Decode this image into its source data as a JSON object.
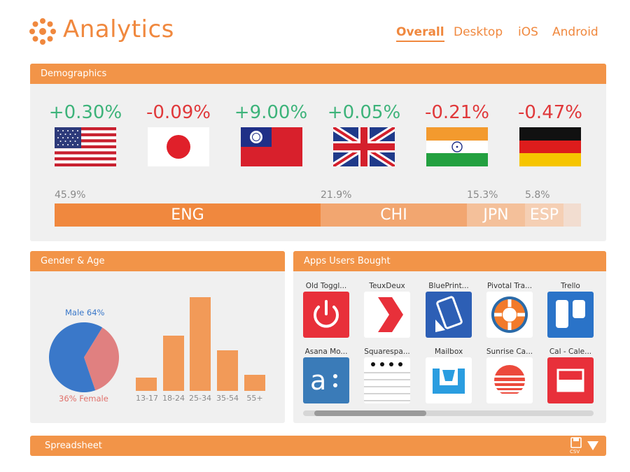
{
  "header": {
    "title": "Analytics",
    "tabs": [
      {
        "label": "Overall",
        "active": true
      },
      {
        "label": "Desktop",
        "active": false
      },
      {
        "label": "iOS",
        "active": false
      },
      {
        "label": "Android",
        "active": false
      }
    ]
  },
  "colors": {
    "accent": "#f0883e",
    "panel_header": "#f29448",
    "positive": "#3db37a",
    "negative": "#e0383a"
  },
  "demographics": {
    "title": "Demographics",
    "countries": [
      {
        "flag": "usa-flag",
        "change": "+0.30%",
        "trend": "positive"
      },
      {
        "flag": "japan-flag",
        "change": "-0.09%",
        "trend": "negative"
      },
      {
        "flag": "taiwan-flag",
        "change": "+9.00%",
        "trend": "positive"
      },
      {
        "flag": "uk-flag",
        "change": "+0.05%",
        "trend": "positive"
      },
      {
        "flag": "india-flag",
        "change": "-0.21%",
        "trend": "negative"
      },
      {
        "flag": "germany-flag",
        "change": "-0.47%",
        "trend": "negative"
      }
    ],
    "languages": [
      {
        "label": "ENG",
        "percent": "45.9%",
        "share": 45.9,
        "color": "#f0883e"
      },
      {
        "label": "CHI",
        "percent": "21.9%",
        "share": 21.9,
        "color": "#f2a670"
      },
      {
        "label": "JPN",
        "percent": "15.3%",
        "share": 15.3,
        "color": "#f4c09a"
      },
      {
        "label": "ESP",
        "percent": "5.8%",
        "share": 5.8,
        "color": "#f5cfb4"
      },
      {
        "label": "",
        "percent": "",
        "share": 3.0,
        "color": "#f2ddd0"
      }
    ]
  },
  "gender_age": {
    "title": "Gender & Age",
    "male_label": "Male 64%",
    "female_label": "36% Female",
    "male_share": 64,
    "female_share": 36,
    "male_color": "#3a78c9",
    "female_color": "#e08080",
    "age_groups": [
      "13-17",
      "18-24",
      "25-34",
      "35-54",
      "55+"
    ],
    "age_values": [
      13,
      55,
      93,
      40,
      16
    ]
  },
  "apps": {
    "title": "Apps Users Bought",
    "items": [
      {
        "name": "Old Toggl...",
        "icon": "power-icon",
        "color": "#e8303a"
      },
      {
        "name": "TeuxDeux",
        "icon": "chevron-right-icon",
        "color": "#ffffff"
      },
      {
        "name": "BluePrint...",
        "icon": "phone-icon",
        "color": "#2d5fb5"
      },
      {
        "name": "Pivotal Tra...",
        "icon": "gear-icon",
        "color": "#ffffff"
      },
      {
        "name": "Trello",
        "icon": "trello-board-icon",
        "color": "#2a73c8"
      },
      {
        "name": "Asana Mo...",
        "icon": "asana-icon",
        "color": "#3a7bb8"
      },
      {
        "name": "Squarespa...",
        "icon": "notebook-icon",
        "color": "#ffffff"
      },
      {
        "name": "Mailbox",
        "icon": "inbox-tray-icon",
        "color": "#ffffff"
      },
      {
        "name": "Sunrise Ca...",
        "icon": "sunrise-icon",
        "color": "#ffffff"
      },
      {
        "name": "Cal - Cale...",
        "icon": "calendar-icon",
        "color": "#e8303a"
      }
    ]
  },
  "spreadsheet": {
    "title": "Spreadsheet",
    "save_label": "CSV"
  }
}
